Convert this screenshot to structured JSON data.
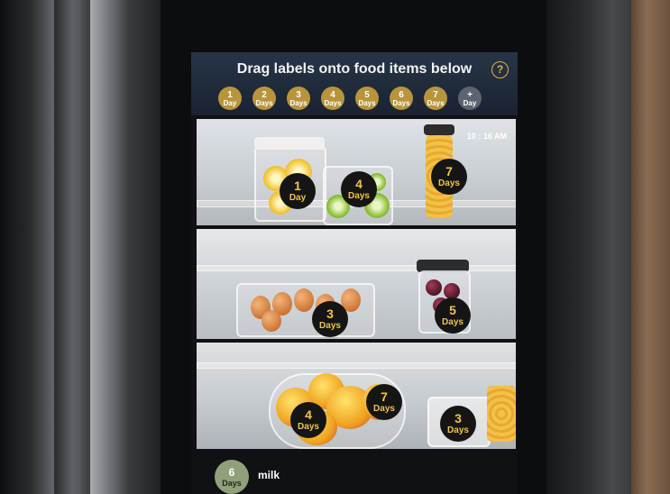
{
  "header": {
    "title": "Drag labels onto food items below",
    "help_glyph": "?"
  },
  "labels": [
    {
      "n": "1",
      "unit": "Day"
    },
    {
      "n": "2",
      "unit": "Days"
    },
    {
      "n": "3",
      "unit": "Days"
    },
    {
      "n": "4",
      "unit": "Days"
    },
    {
      "n": "5",
      "unit": "Days"
    },
    {
      "n": "6",
      "unit": "Days"
    },
    {
      "n": "7",
      "unit": "Days"
    },
    {
      "n": "+",
      "unit": "Day"
    }
  ],
  "clock": "10 : 16 AM",
  "shelf1": {
    "lemons": {
      "n": "1",
      "unit": "Day"
    },
    "limes": {
      "n": "4",
      "unit": "Days"
    },
    "pasta": {
      "n": "7",
      "unit": "Days"
    }
  },
  "shelf2": {
    "eggs": {
      "n": "3",
      "unit": "Days"
    },
    "berries": {
      "n": "5",
      "unit": "Days"
    }
  },
  "shelf3": {
    "fruit_left": {
      "n": "4",
      "unit": "Days"
    },
    "fruit_right": {
      "n": "7",
      "unit": "Days"
    },
    "container": {
      "n": "3",
      "unit": "Days"
    }
  },
  "footer": {
    "milk_badge": {
      "n": "6",
      "unit": "Days"
    },
    "milk_label": "milk"
  },
  "colors": {
    "label_chip": "#b8953c",
    "badge_text": "#f0c44a",
    "help_accent": "#e0b04a"
  }
}
